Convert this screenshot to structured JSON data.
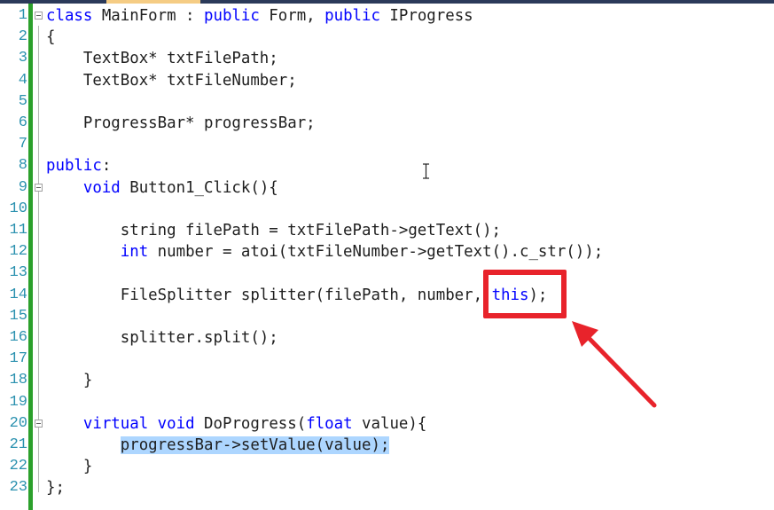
{
  "editor": {
    "lines": [
      {
        "n": "1",
        "segments": [
          {
            "t": "class",
            "k": "kw"
          },
          {
            "t": " MainForm : "
          },
          {
            "t": "public",
            "k": "kw"
          },
          {
            "t": " Form, "
          },
          {
            "t": "public",
            "k": "kw"
          },
          {
            "t": " IProgress"
          }
        ]
      },
      {
        "n": "2",
        "segments": [
          {
            "t": "{"
          }
        ]
      },
      {
        "n": "3",
        "segments": [
          {
            "t": "    TextBox* txtFilePath;"
          }
        ]
      },
      {
        "n": "4",
        "segments": [
          {
            "t": "    TextBox* txtFileNumber;"
          }
        ]
      },
      {
        "n": "5",
        "segments": []
      },
      {
        "n": "6",
        "segments": [
          {
            "t": "    ProgressBar* progressBar;"
          }
        ]
      },
      {
        "n": "7",
        "segments": []
      },
      {
        "n": "8",
        "segments": [
          {
            "t": "public",
            "k": "kw"
          },
          {
            "t": ":"
          }
        ]
      },
      {
        "n": "9",
        "segments": [
          {
            "t": "    "
          },
          {
            "t": "void",
            "k": "kw"
          },
          {
            "t": " Button1_Click(){"
          }
        ]
      },
      {
        "n": "10",
        "segments": []
      },
      {
        "n": "11",
        "segments": [
          {
            "t": "        string filePath = txtFilePath->getText();"
          }
        ]
      },
      {
        "n": "12",
        "segments": [
          {
            "t": "        "
          },
          {
            "t": "int",
            "k": "kw"
          },
          {
            "t": " number = atoi(txtFileNumber->getText().c_str());"
          }
        ]
      },
      {
        "n": "13",
        "segments": []
      },
      {
        "n": "14",
        "segments": [
          {
            "t": "        FileSplitter splitter(filePath, number, "
          },
          {
            "t": "this",
            "k": "kw"
          },
          {
            "t": ");"
          }
        ]
      },
      {
        "n": "15",
        "segments": []
      },
      {
        "n": "16",
        "segments": [
          {
            "t": "        splitter.split();"
          }
        ]
      },
      {
        "n": "17",
        "segments": []
      },
      {
        "n": "18",
        "segments": [
          {
            "t": "    }"
          }
        ]
      },
      {
        "n": "19",
        "segments": []
      },
      {
        "n": "20",
        "segments": [
          {
            "t": "    "
          },
          {
            "t": "virtual",
            "k": "kw"
          },
          {
            "t": " "
          },
          {
            "t": "void",
            "k": "kw"
          },
          {
            "t": " DoProgress("
          },
          {
            "t": "float",
            "k": "kw"
          },
          {
            "t": " value){"
          }
        ]
      },
      {
        "n": "21",
        "segments": [
          {
            "t": "        "
          },
          {
            "t": "progressBar->setValue(value);",
            "k": "hl"
          }
        ]
      },
      {
        "n": "22",
        "segments": [
          {
            "t": "    }"
          }
        ]
      },
      {
        "n": "23",
        "segments": [
          {
            "t": "};"
          }
        ]
      }
    ],
    "fold_lines": [
      "1",
      "9",
      "20"
    ]
  },
  "colors": {
    "keyword": "#0000ff",
    "line_number": "#2b91af",
    "change_bar": "#2ca02c",
    "selection": "#add6ff",
    "annotation": "#e8232b"
  },
  "icons": {
    "fold": "collapse-box-icon",
    "cursor": "text-i-beam-cursor-icon",
    "annotation": "red-arrow-icon"
  }
}
